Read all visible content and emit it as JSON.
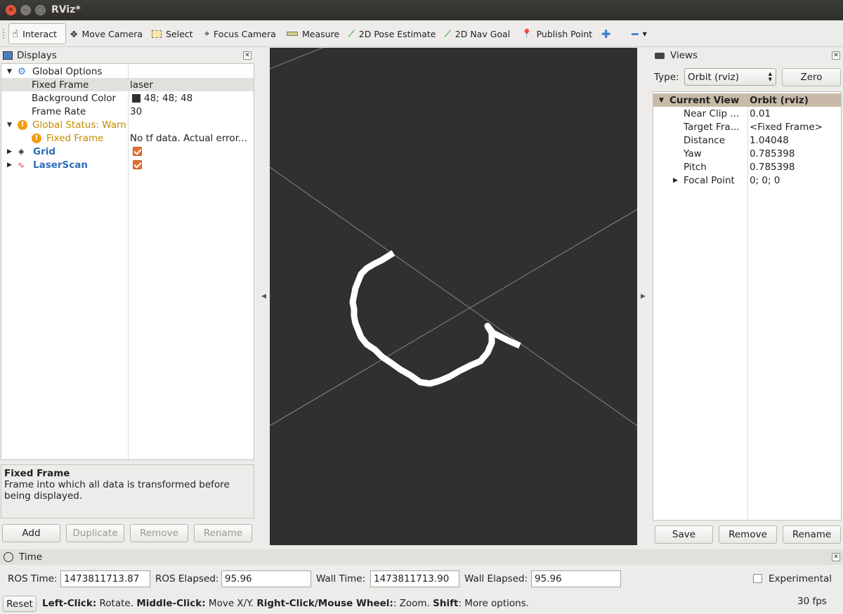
{
  "window": {
    "title": "RViz*"
  },
  "toolbar": {
    "interact": "Interact",
    "move_camera": "Move Camera",
    "select": "Select",
    "focus_camera": "Focus Camera",
    "measure": "Measure",
    "pose_estimate": "2D Pose Estimate",
    "nav_goal": "2D Nav Goal",
    "publish_point": "Publish Point"
  },
  "displays": {
    "title": "Displays",
    "global_options": "Global Options",
    "fixed_frame_label": "Fixed Frame",
    "fixed_frame_value": "laser",
    "bg_color_label": "Background Color",
    "bg_color_value": "48; 48; 48",
    "bg_color_hex": "#303030",
    "frame_rate_label": "Frame Rate",
    "frame_rate_value": "30",
    "global_status": "Global Status: Warn",
    "status_fixed_frame": "Fixed Frame",
    "status_error": "No tf data.  Actual error...",
    "grid": "Grid",
    "laserscan": "LaserScan",
    "desc_title": "Fixed Frame",
    "desc_text": "Frame into which all data is transformed before being displayed.",
    "buttons": {
      "add": "Add",
      "duplicate": "Duplicate",
      "remove": "Remove",
      "rename": "Rename"
    }
  },
  "views": {
    "title": "Views",
    "type_label": "Type:",
    "type_value": "Orbit (rviz)",
    "zero": "Zero",
    "current_view": "Current View",
    "current_view_value": "Orbit (rviz)",
    "props": [
      {
        "k": "Near Clip ...",
        "v": "0.01"
      },
      {
        "k": "Target Fra...",
        "v": "<Fixed Frame>"
      },
      {
        "k": "Distance",
        "v": "1.04048"
      },
      {
        "k": "Yaw",
        "v": "0.785398"
      },
      {
        "k": "Pitch",
        "v": "0.785398"
      },
      {
        "k": "Focal Point",
        "v": "0; 0; 0"
      }
    ],
    "buttons": {
      "save": "Save",
      "remove": "Remove",
      "rename": "Rename"
    }
  },
  "time": {
    "title": "Time",
    "ros_time_label": "ROS Time:",
    "ros_time": "1473811713.87",
    "ros_elapsed_label": "ROS Elapsed:",
    "ros_elapsed": "95.96",
    "wall_time_label": "Wall Time:",
    "wall_time": "1473811713.90",
    "wall_elapsed_label": "Wall Elapsed:",
    "wall_elapsed": "95.96",
    "experimental": "Experimental"
  },
  "statusbar": {
    "reset": "Reset",
    "lc": "Left-Click:",
    "lc_t": " Rotate. ",
    "mc": "Middle-Click:",
    "mc_t": " Move X/Y. ",
    "rc": "Right-Click/Mouse Wheel:",
    "rc_t": ": Zoom. ",
    "sh": "Shift",
    "sh_t": ": More options.",
    "fps": "30 fps"
  },
  "colors": {
    "viewport_bg": "#303030",
    "accent_orange": "#e9712f",
    "link_blue": "#2b6db5",
    "warn": "#c58a00"
  }
}
